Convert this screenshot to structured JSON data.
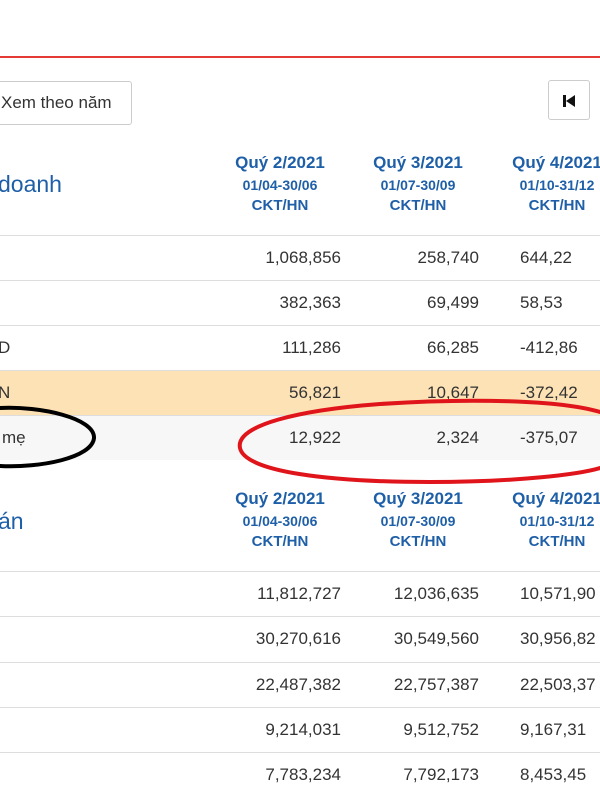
{
  "toolbar": {
    "view_by_year": "Xem theo năm",
    "first_icon": "skip-first-icon"
  },
  "colors": {
    "accent_red": "#e53935",
    "title_blue": "#1e5fa8",
    "highlight_row": "#fde2b5",
    "annotation_red": "#e0151b",
    "annotation_black": "#000000"
  },
  "section1": {
    "title": "doanh",
    "columns": [
      {
        "quarter": "Quý 2/2021",
        "range": "01/04-30/06",
        "type": "CKT/HN"
      },
      {
        "quarter": "Quý 3/2021",
        "range": "01/07-30/09",
        "type": "CKT/HN"
      },
      {
        "quarter": "Quý 4/2021",
        "range": "01/10-31/12",
        "type": "CKT/HN"
      }
    ],
    "rows": [
      {
        "label": "",
        "values": [
          "1,068,856",
          "258,740",
          "644,22"
        ]
      },
      {
        "label": "",
        "values": [
          "382,363",
          "69,499",
          "58,53"
        ]
      },
      {
        "label": "D",
        "values": [
          "111,286",
          "66,285",
          "-412,86"
        ]
      },
      {
        "label": "N",
        "values": [
          "56,821",
          "10,647",
          "-372,42"
        ]
      },
      {
        "label": "mẹ",
        "values": [
          "12,922",
          "2,324",
          "-375,07"
        ]
      }
    ]
  },
  "section2": {
    "title": "án",
    "columns": [
      {
        "quarter": "Quý 2/2021",
        "range": "01/04-30/06",
        "type": "CKT/HN"
      },
      {
        "quarter": "Quý 3/2021",
        "range": "01/07-30/09",
        "type": "CKT/HN"
      },
      {
        "quarter": "Quý 4/2021",
        "range": "01/10-31/12",
        "type": "CKT/HN"
      }
    ],
    "rows": [
      {
        "label": "",
        "values": [
          "11,812,727",
          "12,036,635",
          "10,571,90"
        ]
      },
      {
        "label": "",
        "values": [
          "30,270,616",
          "30,549,560",
          "30,956,82"
        ]
      },
      {
        "label": "",
        "values": [
          "22,487,382",
          "22,757,387",
          "22,503,37"
        ]
      },
      {
        "label": "",
        "values": [
          "9,214,031",
          "9,512,752",
          "9,167,31"
        ]
      },
      {
        "label": "",
        "values": [
          "7,783,234",
          "7,792,173",
          "8,453,45"
        ]
      }
    ]
  }
}
